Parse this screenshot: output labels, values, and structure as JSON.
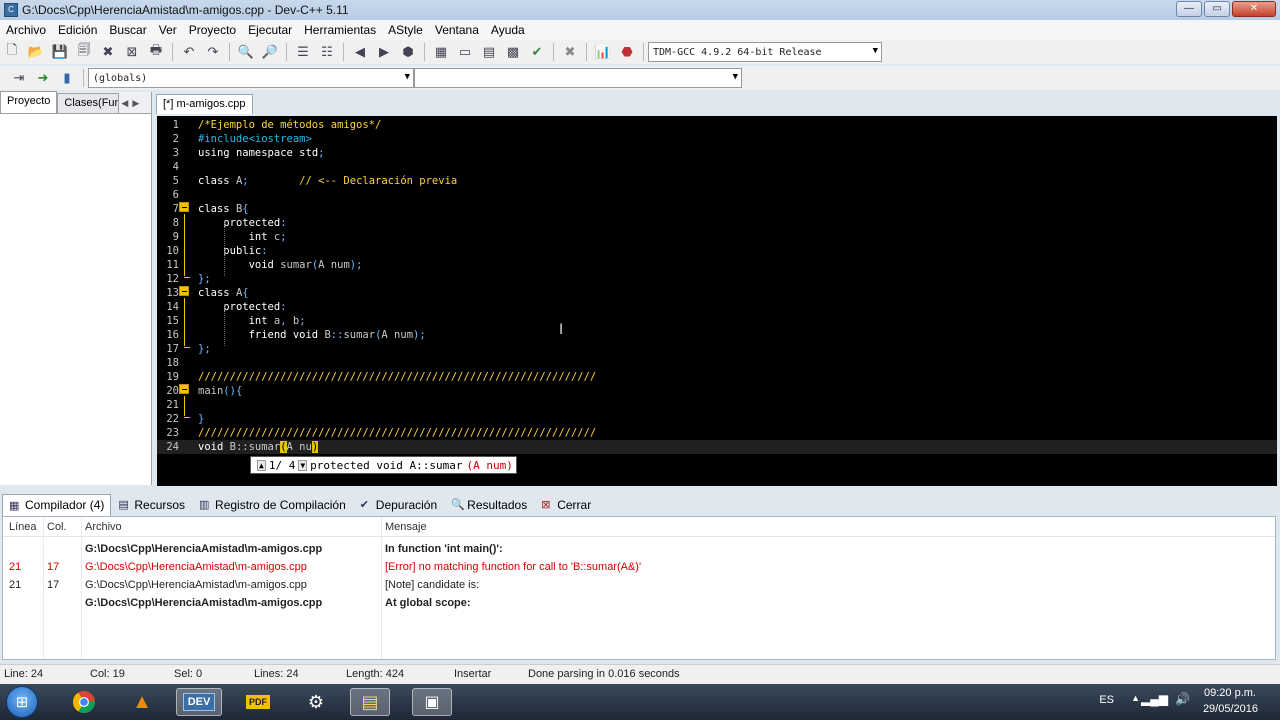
{
  "window": {
    "title": "G:\\Docs\\Cpp\\HerenciaAmistad\\m-amigos.cpp - Dev-C++ 5.11",
    "minimize": "—",
    "maximize": "▭",
    "close": "✕"
  },
  "menu": [
    "Archivo",
    "Edición",
    "Buscar",
    "Ver",
    "Proyecto",
    "Ejecutar",
    "Herramientas",
    "AStyle",
    "Ventana",
    "Ayuda"
  ],
  "toolbar": {
    "compiler_select": "TDM-GCC 4.9.2 64-bit Release",
    "scope_select": "(globals)",
    "member_select": ""
  },
  "left_pane": {
    "tabs": [
      "Proyecto",
      "Clases(Fun"
    ]
  },
  "editor": {
    "tab_label": "[*] m-amigos.cpp",
    "lines": [
      {
        "n": "1",
        "text": "/*Ejemplo de métodos amigos*/"
      },
      {
        "n": "2",
        "text": "#include<iostream>"
      },
      {
        "n": "3",
        "text": "using namespace std;"
      },
      {
        "n": "4",
        "text": ""
      },
      {
        "n": "5",
        "text": "class A;        // <-- Declaración previa"
      },
      {
        "n": "6",
        "text": ""
      },
      {
        "n": "7",
        "text": "class B{"
      },
      {
        "n": "8",
        "text": "    protected:"
      },
      {
        "n": "9",
        "text": "        int c;"
      },
      {
        "n": "10",
        "text": "    public:"
      },
      {
        "n": "11",
        "text": "        void sumar(A num);"
      },
      {
        "n": "12",
        "text": "};"
      },
      {
        "n": "13",
        "text": "class A{"
      },
      {
        "n": "14",
        "text": "    protected:"
      },
      {
        "n": "15",
        "text": "        int a, b;"
      },
      {
        "n": "16",
        "text": "        friend void B::sumar(A num);"
      },
      {
        "n": "17",
        "text": "};"
      },
      {
        "n": "18",
        "text": ""
      },
      {
        "n": "19",
        "text": "///////////////////////////////////////////////////////////////"
      },
      {
        "n": "20",
        "text": "main(){"
      },
      {
        "n": "21",
        "text": ""
      },
      {
        "n": "22",
        "text": "}"
      },
      {
        "n": "23",
        "text": "///////////////////////////////////////////////////////////////"
      },
      {
        "n": "24",
        "text": "void B::sumar(A nu)"
      }
    ]
  },
  "tooltip": {
    "counter": "1/ 4",
    "signature": "protected void A::sumar",
    "param": "(A num)"
  },
  "bottom_tabs": [
    "Compilador (4)",
    "Recursos",
    "Registro de Compilación",
    "Depuración",
    "Resultados",
    "Cerrar"
  ],
  "messages": {
    "headers": {
      "line": "Línea",
      "col": "Col.",
      "file": "Archivo",
      "msg": "Mensaje"
    },
    "rows": [
      {
        "line": "",
        "col": "",
        "file": "G:\\Docs\\Cpp\\HerenciaAmistad\\m-amigos.cpp",
        "msg": "In function 'int main()':"
      },
      {
        "line": "21",
        "col": "17",
        "file": "G:\\Docs\\Cpp\\HerenciaAmistad\\m-amigos.cpp",
        "msg": "[Error] no matching function for call to 'B::sumar(A&)'"
      },
      {
        "line": "21",
        "col": "17",
        "file": "G:\\Docs\\Cpp\\HerenciaAmistad\\m-amigos.cpp",
        "msg": "[Note] candidate is:"
      },
      {
        "line": "",
        "col": "",
        "file": "G:\\Docs\\Cpp\\HerenciaAmistad\\m-amigos.cpp",
        "msg": "At global scope:"
      }
    ]
  },
  "status": {
    "line": "Line:  24",
    "col": "Col:  19",
    "sel": "Sel:  0",
    "lines": "Lines:  24",
    "length": "Length:  424",
    "mode": "Insertar",
    "parse": "Done parsing in 0.016 seconds"
  },
  "taskbar": {
    "lang": "ES",
    "time": "09:20 p.m.",
    "date": "29/05/2016",
    "dev_label": "DEV",
    "pdf_label": "PDF"
  }
}
